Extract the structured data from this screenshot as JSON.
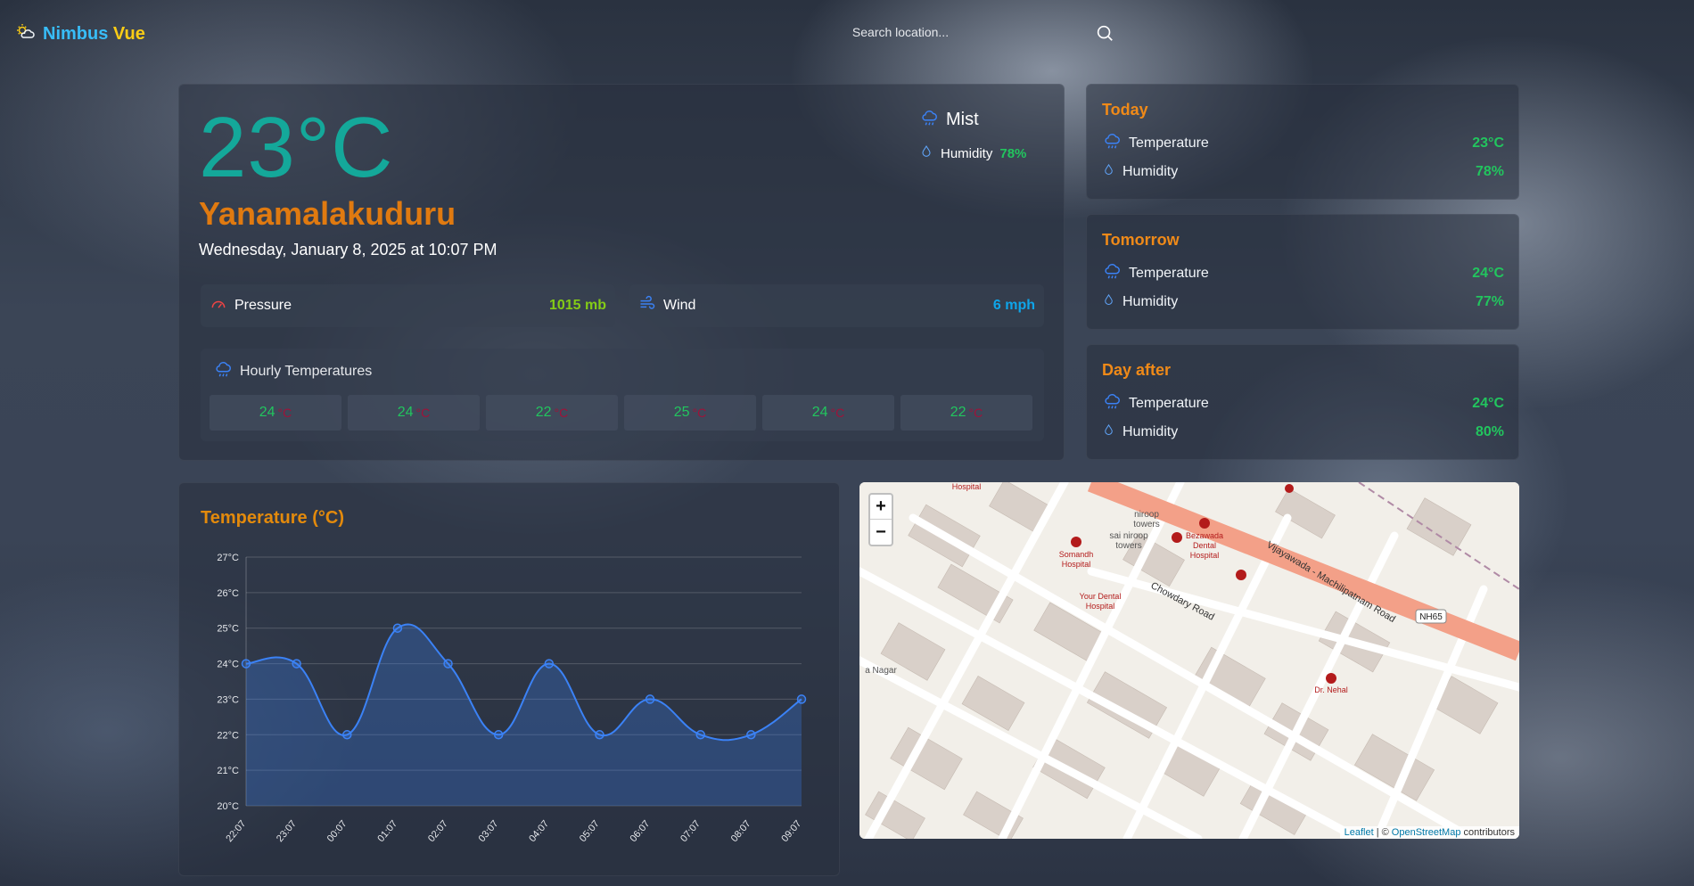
{
  "app": {
    "name_part1": "Nimbus",
    "name_part2": "Vue"
  },
  "search": {
    "placeholder": "Search location..."
  },
  "current": {
    "temperature": "23°C",
    "city": "Yanamalakuduru",
    "datetime": "Wednesday, January 8, 2025 at 10:07 PM",
    "condition": "Mist",
    "humidity_label": "Humidity",
    "humidity_value": "78%",
    "pressure_label": "Pressure",
    "pressure_value": "1015 mb",
    "wind_label": "Wind",
    "wind_value": "6 mph"
  },
  "hourly": {
    "title": "Hourly Temperatures",
    "unit": "°C",
    "items": [
      "24",
      "24",
      "22",
      "25",
      "24",
      "22"
    ]
  },
  "forecast": [
    {
      "title": "Today",
      "temp_label": "Temperature",
      "temp_value": "23°C",
      "hum_label": "Humidity",
      "hum_value": "78%"
    },
    {
      "title": "Tomorrow",
      "temp_label": "Temperature",
      "temp_value": "24°C",
      "hum_label": "Humidity",
      "hum_value": "77%"
    },
    {
      "title": "Day after",
      "temp_label": "Temperature",
      "temp_value": "24°C",
      "hum_label": "Humidity",
      "hum_value": "80%"
    }
  ],
  "chart_data": {
    "type": "line",
    "title": "Temperature (°C)",
    "xlabel": "",
    "ylabel": "",
    "categories": [
      "22:07",
      "23:07",
      "00:07",
      "01:07",
      "02:07",
      "03:07",
      "04:07",
      "05:07",
      "06:07",
      "07:07",
      "08:07",
      "09:07"
    ],
    "values": [
      24,
      24,
      22,
      25,
      24,
      22,
      24,
      22,
      23,
      22,
      22,
      23
    ],
    "ylim": [
      20,
      27
    ],
    "ytick_labels": [
      "27°C",
      "26°C",
      "25°C",
      "24°C",
      "23°C",
      "22°C",
      "21°C",
      "20°C"
    ],
    "grid": true,
    "line_color": "#3b82f6"
  },
  "map": {
    "zoom_in": "+",
    "zoom_out": "−",
    "attribution_leaflet": "Leaflet",
    "attribution_sep": "| ©",
    "attribution_osm": "OpenStreetMap",
    "attribution_rest": "contributors",
    "labels": {
      "road1": "Vijayawada - Machilipatnam Road",
      "road2": "Chowdary Road",
      "shield": "NH65",
      "hosp1a": "Somandh",
      "hosp1b": "Hospital",
      "hosp2a": "Bezawada",
      "hosp2b": "Dental",
      "hosp2c": "Hospital",
      "hosp3a": "Your Dental",
      "hosp3b": "Hospital",
      "hosp4": "Hospital",
      "tower1a": "niroop",
      "tower1b": "towers",
      "tower2a": "sai niroop",
      "tower2b": "towers",
      "clinic": "Dr. Nehal",
      "area": "a Nagar"
    }
  }
}
